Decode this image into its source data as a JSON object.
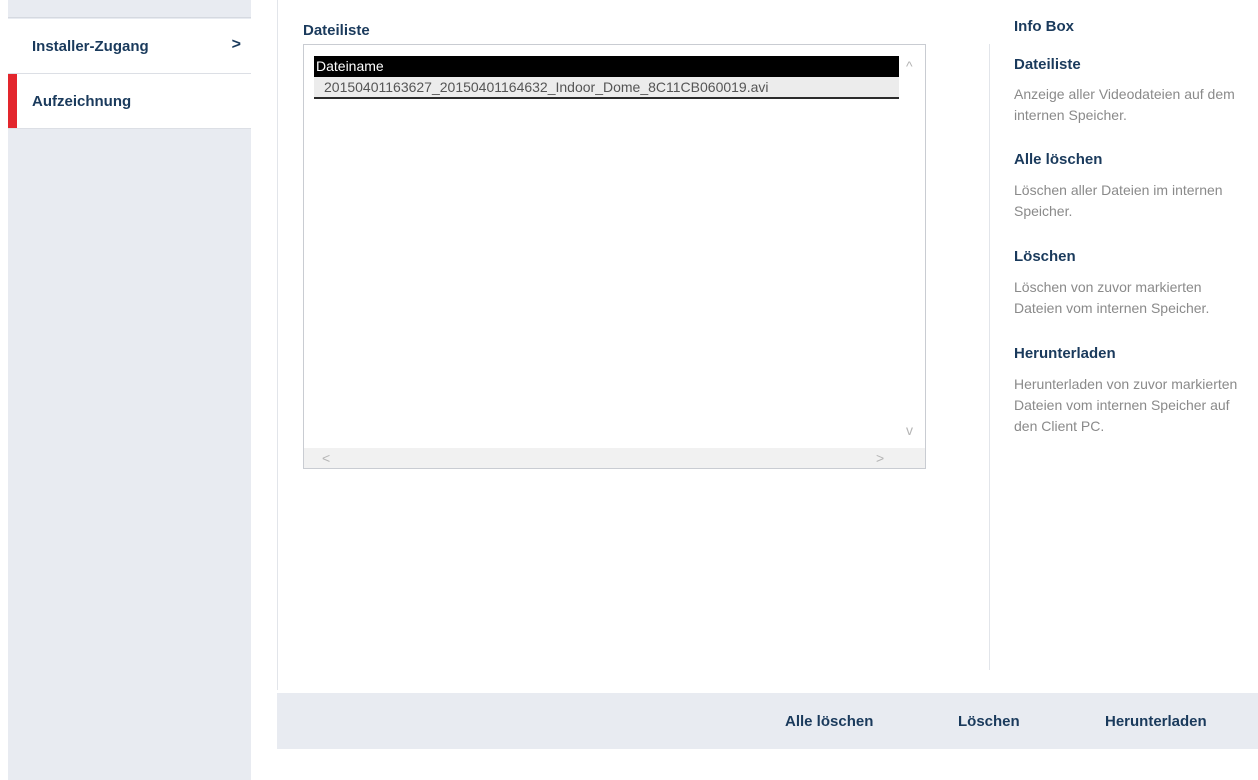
{
  "sidebar": {
    "items": [
      {
        "label": "Installer-Zugang",
        "chevron": ">"
      },
      {
        "label": "Aufzeichnung"
      }
    ],
    "active_color": "#e3262d"
  },
  "file_list": {
    "title": "Dateiliste",
    "columns": [
      "Dateiname"
    ],
    "rows": [
      "20150401163627_20150401164632_Indoor_Dome_8C11CB060019.avi"
    ],
    "scroll_arrows": {
      "up": "^",
      "down": "v",
      "left": "<",
      "right": ">"
    }
  },
  "info_box": {
    "title": "Info Box",
    "entries": [
      {
        "heading": "Dateiliste",
        "text": "Anzeige aller Videodateien auf dem internen Speicher."
      },
      {
        "heading": "Alle löschen",
        "text": "Löschen aller Dateien im internen Speicher."
      },
      {
        "heading": "Löschen",
        "text": "Löschen von zuvor markierten Dateien vom internen Speicher."
      },
      {
        "heading": "Herunterladen",
        "text": "Herunterladen von zuvor markierten Dateien vom internen Speicher auf den Client PC."
      }
    ]
  },
  "actions": {
    "delete_all": "Alle löschen",
    "delete": "Löschen",
    "download": "Herunterladen"
  }
}
